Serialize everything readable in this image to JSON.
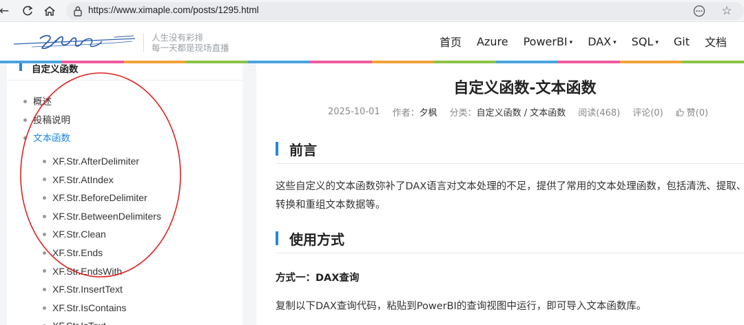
{
  "browser": {
    "url": "https://www.ximaple.com/posts/1295.html"
  },
  "header": {
    "slogan_line1": "人生没有彩排",
    "slogan_line2": "每一天都是现场直播",
    "nav": [
      {
        "label": "首页",
        "has_caret": false
      },
      {
        "label": "Azure",
        "has_caret": false
      },
      {
        "label": "PowerBI",
        "has_caret": true
      },
      {
        "label": "DAX",
        "has_caret": true
      },
      {
        "label": "SQL",
        "has_caret": true
      },
      {
        "label": "Git",
        "has_caret": false
      },
      {
        "label": "文档",
        "has_caret": false
      }
    ],
    "strip_colors": [
      "#4aa3df",
      "#ee5a9c",
      "#f2a33a",
      "#8bc34a",
      "#4aa3df",
      "#ee5a9c",
      "#f2a33a",
      "#8bc34a",
      "#4aa3df",
      "#ee5a9c",
      "#f2a33a",
      "#8bc34a"
    ]
  },
  "sidebar": {
    "title": "自定义函数",
    "items": [
      {
        "label": "概述",
        "active": false
      },
      {
        "label": "投稿说明",
        "active": false
      },
      {
        "label": "文本函数",
        "active": true
      }
    ],
    "sub_items": [
      "XF.Str.AfterDelimiter",
      "XF.Str.AtIndex",
      "XF.Str.BeforeDelimiter",
      "XF.Str.BetweenDelimiters",
      "XF.Str.Clean",
      "XF.Str.Ends",
      "XF.Str.EndsWith",
      "XF.Str.InsertText",
      "XF.Str.IsContains",
      "XF.Str.IsText"
    ]
  },
  "article": {
    "title": "自定义函数-文本函数",
    "date": "2025-10-01",
    "author_label": "作者：",
    "author": "夕枫",
    "category_label": "分类：",
    "category": "自定义函数 / 文本函数",
    "reads": "阅读(468)",
    "comments": "评论(0)",
    "likes": "赞(0)",
    "section1": "前言",
    "para1_line1": "这些自定义的文本函数弥补了DAX语言对文本处理的不足，提供了常用的文本处理函数，包括清洗、提取、",
    "para1_line2": "转换和重组文本数据等。",
    "section2": "使用方式",
    "method1": "方式一：DAX查询",
    "para2": "复制以下DAX查询代码，粘贴到PowerBI的查询视图中运行，即可导入文本函数库。"
  }
}
